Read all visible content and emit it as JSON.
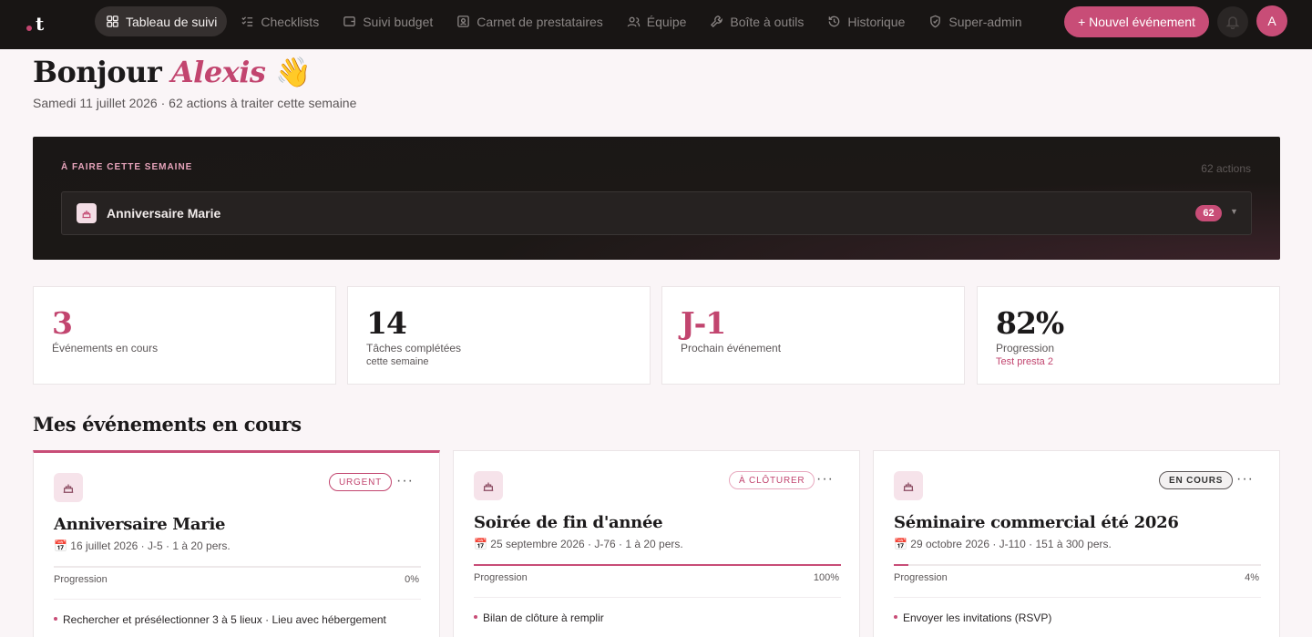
{
  "nav": {
    "items": [
      {
        "label": "Tableau de suivi",
        "icon": "grid-icon",
        "active": true
      },
      {
        "label": "Checklists",
        "icon": "checklist-icon"
      },
      {
        "label": "Suivi budget",
        "icon": "wallet-icon"
      },
      {
        "label": "Carnet de prestataires",
        "icon": "contact-card-icon"
      },
      {
        "label": "Équipe",
        "icon": "team-icon"
      },
      {
        "label": "Boîte à outils",
        "icon": "wrench-icon"
      },
      {
        "label": "Historique",
        "icon": "history-icon"
      },
      {
        "label": "Super-admin",
        "icon": "shield-icon"
      }
    ],
    "new_event": "+ Nouvel événement",
    "avatar": "A"
  },
  "greeting": {
    "prefix": "Bonjour",
    "name": "Alexis",
    "emoji": "👋",
    "subline": "Samedi 11 juillet 2026 · 62 actions à traiter cette semaine"
  },
  "todo": {
    "title": "À FAIRE CETTE SEMAINE",
    "count": "62 actions",
    "row_label": "Anniversaire Marie",
    "row_badge": "62"
  },
  "kpis": [
    {
      "value": "3",
      "label": "Événements en cours",
      "sub": ""
    },
    {
      "value": "14",
      "label": "Tâches complétées",
      "sub": "cette semaine"
    },
    {
      "value": "J-1",
      "label": "Prochain événement",
      "sub": ""
    },
    {
      "value": "82%",
      "label": "Progression",
      "sub": "Test presta 2"
    }
  ],
  "section_title": "Mes événements en cours",
  "events": [
    {
      "status": "URGENT",
      "title": "Anniversaire Marie",
      "meta": "📅 16 juillet 2026 · J-5 · 1 à 20 pers.",
      "progress_label": "Progression",
      "progress_value": "0%",
      "progress_fraction": 0,
      "task": "Rechercher et présélectionner 3 à 5 lieux · Lieu avec hébergement"
    },
    {
      "status": "À CLÔTURER",
      "title": "Soirée de fin d'année",
      "meta": "📅 25 septembre 2026 · J-76 · 1 à 20 pers.",
      "progress_label": "Progression",
      "progress_value": "100%",
      "progress_fraction": 1,
      "task": "Bilan de clôture à remplir"
    },
    {
      "status": "EN COURS",
      "title": "Séminaire commercial été 2026",
      "meta": "📅 29 octobre 2026 · J-110 · 151 à 300 pers.",
      "progress_label": "Progression",
      "progress_value": "4%",
      "progress_fraction": 0.04,
      "task": "Envoyer les invitations (RSVP)"
    }
  ],
  "colors": {
    "accent": "#c84d77",
    "topbar": "#181514",
    "background": "#faf5f7"
  }
}
